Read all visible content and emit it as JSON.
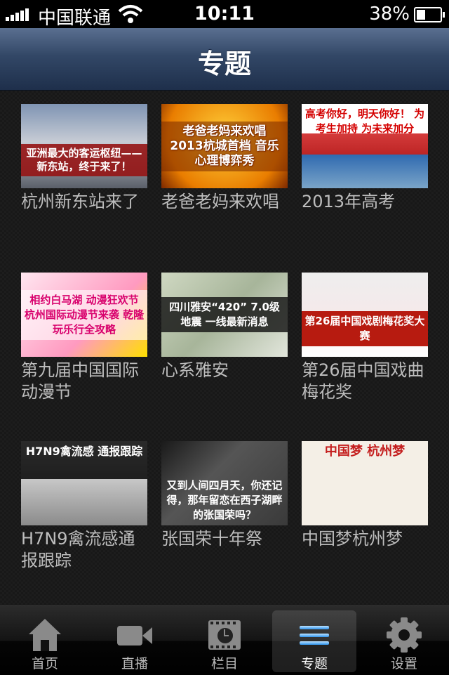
{
  "status_bar": {
    "carrier": "中国联通",
    "time": "10:11",
    "battery": "38%",
    "battery_level": 0.38
  },
  "nav": {
    "title": "专题"
  },
  "topics": [
    {
      "caption": "杭州新东站来了",
      "thumb_text": "亚洲最大的客运枢纽——新东站，终于来了！"
    },
    {
      "caption": "老爸老妈来欢唱",
      "thumb_text": "老爸老妈来欢唱 2013杭城首档 音乐心理博弈秀"
    },
    {
      "caption": "2013年高考",
      "thumb_text": "高考你好，明天你好！ 为考生加持 为未来加分"
    },
    {
      "caption": "第九届中国国际动漫节",
      "thumb_text": "相约白马湖 动漫狂欢节 杭州国际动漫节来袭 乾隆玩乐行全攻略"
    },
    {
      "caption": "心系雅安",
      "thumb_text": "四川雅安“420” 7.0级地震 一线最新消息"
    },
    {
      "caption": "第26届中国戏曲梅花奖",
      "thumb_text": "第26届中国戏剧梅花奖大赛"
    },
    {
      "caption": "H7N9禽流感通报跟踪",
      "thumb_text": "H7N9禽流感 通报跟踪"
    },
    {
      "caption": "张国荣十年祭",
      "thumb_text": "又到人间四月天，你还记得，那年留恋在西子湖畔的张国荣吗？"
    },
    {
      "caption": "中国梦杭州梦",
      "thumb_text": "中国梦 杭州梦"
    }
  ],
  "tabs": [
    {
      "label": "首页",
      "icon": "home-icon"
    },
    {
      "label": "直播",
      "icon": "video-camera-icon"
    },
    {
      "label": "栏目",
      "icon": "film-clock-icon"
    },
    {
      "label": "专题",
      "icon": "list-icon"
    },
    {
      "label": "设置",
      "icon": "gear-icon"
    }
  ],
  "active_tab": "专题"
}
